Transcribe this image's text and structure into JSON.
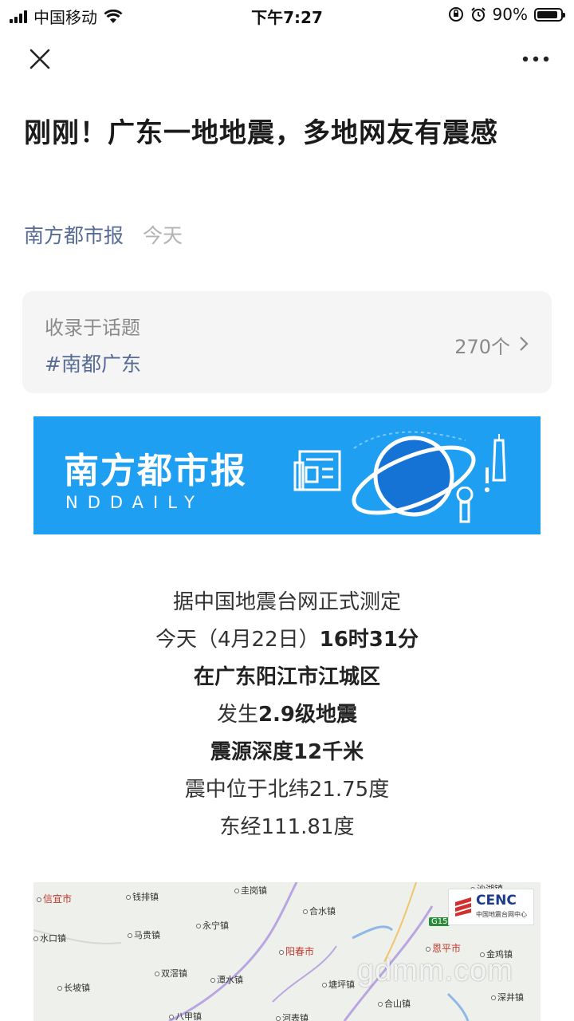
{
  "status_bar": {
    "carrier": "中国移动",
    "time": "下午7:27",
    "battery_percent": "90%",
    "battery_level": 0.9
  },
  "nav": {
    "close_icon": "close-icon",
    "more_icon": "more-icon"
  },
  "article": {
    "title": "刚刚！广东一地地震，多地网友有震感",
    "source": "南方都市报",
    "date": "今天"
  },
  "topic": {
    "label": "收录于话题",
    "tag": "#南都广东",
    "count": "270个"
  },
  "banner": {
    "brand": "南方都市报",
    "sub": "NDDAILY"
  },
  "body": {
    "line1": "据中国地震台网正式测定",
    "line2_pre": "今天（4月22日）",
    "line2_bold": "16时31分",
    "line3": "在广东阳江市江城区",
    "line4_pre": "发生",
    "line4_bold": "2.9级地震",
    "line5": "震源深度12千米",
    "line6": "震中位于北纬21.75度",
    "line7": "东经111.81度"
  },
  "map": {
    "logo": "CENC",
    "logo_sub": "中国地震台网中心",
    "highway": "G15",
    "towns": [
      "信宜市",
      "钱排镇",
      "圭岗镇",
      "合水镇",
      "沙湖镇",
      "马贵镇",
      "永宁镇",
      "阳春市",
      "恩平市",
      "水口镇",
      "金鸡镇",
      "双滘镇",
      "潭水镇",
      "塘坪镇",
      "长坡镇",
      "合山镇",
      "深井镇",
      "八甲镇",
      "河表镇"
    ]
  },
  "watermark": "gdmm.com",
  "colors": {
    "link": "#576b95",
    "banner_bg": "#1e9ff2",
    "card_bg": "#f5f5f5"
  }
}
